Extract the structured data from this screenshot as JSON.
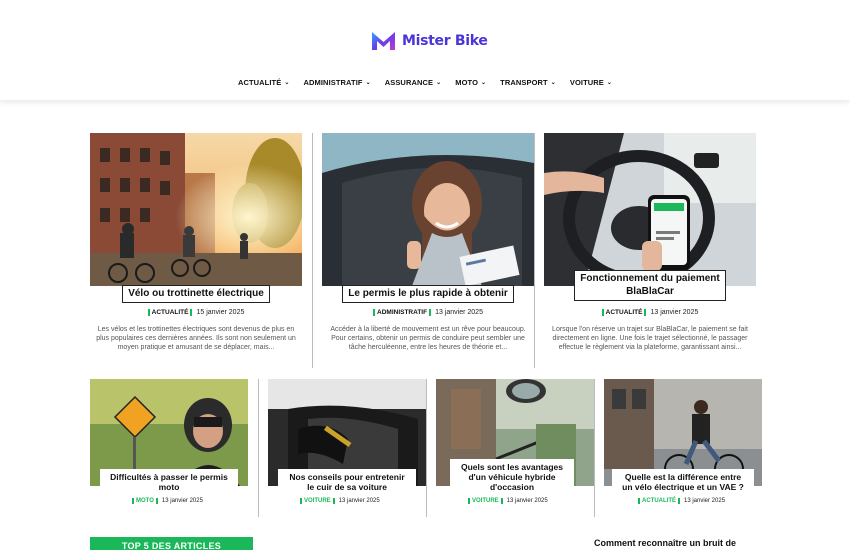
{
  "brand": {
    "name": "Mister Bike",
    "accent": "#4a35d6",
    "green": "#1bb85a"
  },
  "nav": [
    {
      "label": "ACTUALITÉ"
    },
    {
      "label": "ADMINISTRATIF"
    },
    {
      "label": "ASSURANCE"
    },
    {
      "label": "MOTO"
    },
    {
      "label": "TRANSPORT"
    },
    {
      "label": "VOITURE"
    }
  ],
  "featured": [
    {
      "title": "Vélo ou trottinette électrique",
      "category": "ACTUALITÉ",
      "date": "15 janvier 2025",
      "excerpt": "Les vélos et les trottinettes électriques sont devenus de plus en plus populaires ces dernières années. Ils sont non seulement un moyen pratique et amusant de se déplacer, mais..."
    },
    {
      "title": "Le permis le plus rapide à obtenir",
      "category": "ADMINISTRATIF",
      "date": "13 janvier 2025",
      "excerpt": "Accéder à la liberté de mouvement est un rêve pour beaucoup. Pour certains, obtenir un permis de conduire peut sembler une tâche herculéenne, entre les heures de théorie et..."
    },
    {
      "title_line1": "Fonctionnement du paiement",
      "title_line2": "BlaBlaCar",
      "category": "ACTUALITÉ",
      "date": "13 janvier 2025",
      "excerpt": "Lorsque l'on réserve un trajet sur BlaBlaCar, le paiement se fait directement en ligne. Une fois le trajet sélectionné, le passager effectue le règlement via la plateforme, garantissant ainsi..."
    }
  ],
  "articles": [
    {
      "title_line1": "Difficultés à passer le permis",
      "title_line2": "moto",
      "category": "MOTO",
      "date": "13 janvier 2025"
    },
    {
      "title_line1": "Nos conseils pour entretenir",
      "title_line2": "le cuir de sa voiture",
      "category": "VOITURE",
      "date": "13 janvier 2025"
    },
    {
      "title_line1": "Quels sont les avantages",
      "title_line2": "d'un véhicule hybride",
      "title_line3": "d'occasion",
      "category": "VOITURE",
      "date": "13 janvier 2025"
    },
    {
      "title_line1": "Quelle est la différence entre",
      "title_line2": "un vélo électrique et un VAE ?",
      "category": "ACTUALITÉ",
      "date": "13 janvier 2025"
    }
  ],
  "bottom": {
    "top_button": "TOP 5 DES ARTICLES",
    "side_title": "Comment reconnaître un bruit de"
  }
}
